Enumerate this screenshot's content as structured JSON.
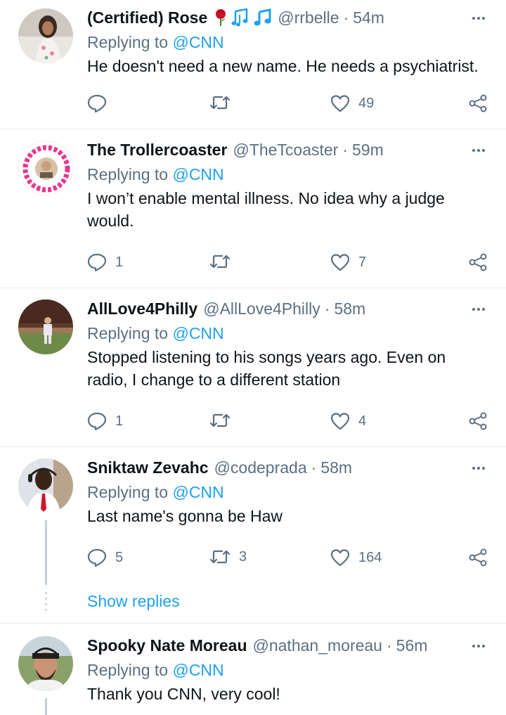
{
  "tweets": [
    {
      "name": "(Certified) Rose",
      "handle": "@rrbelle",
      "time": "54m",
      "replying_label": "Replying to",
      "replying_to": "@CNN",
      "text": "He doesn't need a new name. He needs a psychiatrist.",
      "replies": "",
      "retweets": "",
      "likes": "49",
      "emoji": [
        "rose-icon",
        "music-notes-icon",
        "music-note-icon"
      ]
    },
    {
      "name": "The Trollercoaster",
      "handle": "@TheTcoaster",
      "time": "59m",
      "replying_label": "Replying to",
      "replying_to": "@CNN",
      "text": "I won’t enable mental illness. No idea why a judge would.",
      "replies": "1",
      "retweets": "",
      "likes": "7"
    },
    {
      "name": "AllLove4Philly",
      "handle": "@AllLove4Philly",
      "time": "58m",
      "replying_label": "Replying to",
      "replying_to": "@CNN",
      "text": "Stopped listening to his songs years ago. Even on radio, I change to a different station",
      "replies": "1",
      "retweets": "",
      "likes": "4"
    },
    {
      "name": "Sniktaw Zevahc",
      "handle": "@codeprada",
      "time": "58m",
      "replying_label": "Replying to",
      "replying_to": "@CNN",
      "text": "Last name's gonna be Haw",
      "replies": "5",
      "retweets": "3",
      "likes": "164"
    },
    {
      "name": "Spooky Nate Moreau",
      "handle": "@nathan_moreau",
      "time": "56m",
      "replying_label": "Replying to",
      "replying_to": "@CNN",
      "text": "Thank you CNN, very cool!",
      "replies": "",
      "retweets": "",
      "likes": ""
    }
  ],
  "show_replies": "Show replies",
  "colors": {
    "accent": "#1da1f2",
    "secondary_text": "#5b7083",
    "primary_text": "#0f1419",
    "divider": "#e6ecf0",
    "thread_line": "#c4cfd6"
  }
}
